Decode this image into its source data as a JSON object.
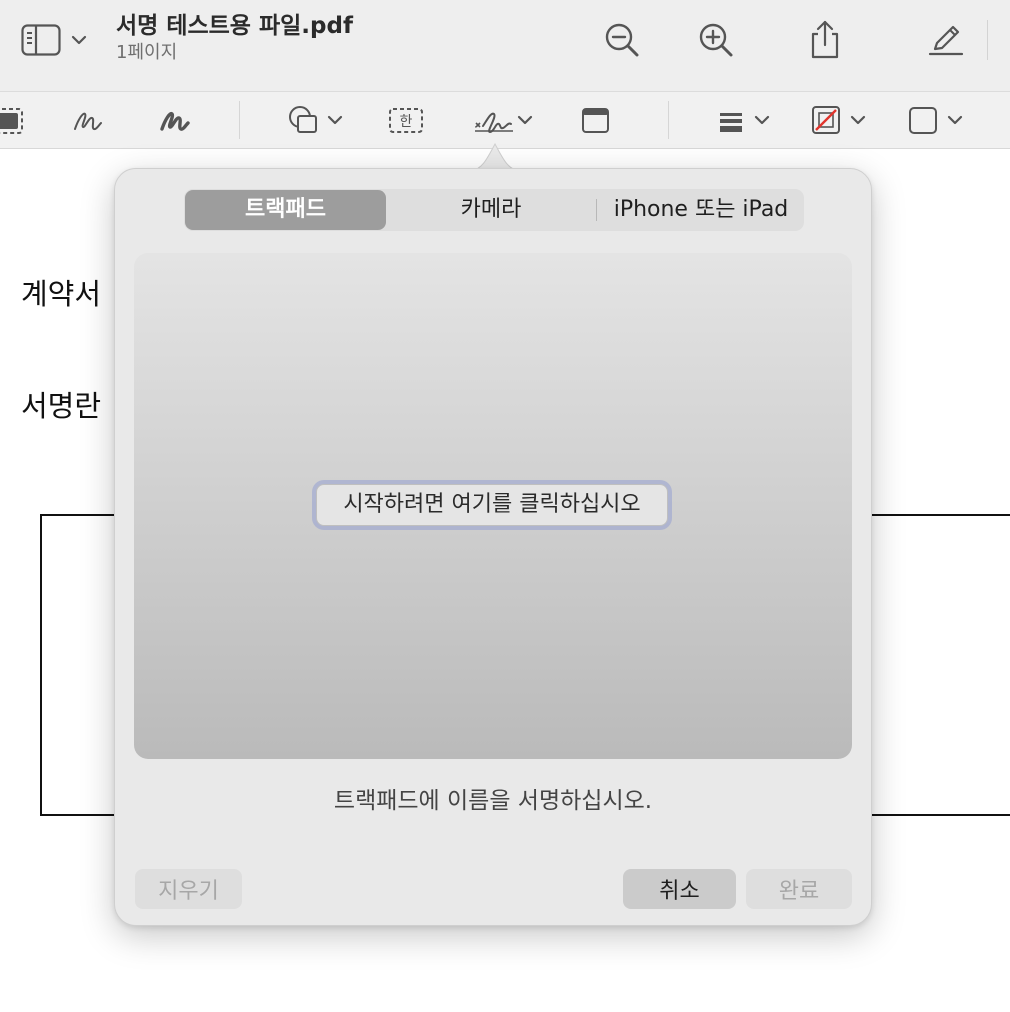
{
  "titlebar": {
    "title": "서명 테스트용 파일.pdf",
    "subtitle": "1페이지",
    "icons": [
      "sidebar-icon",
      "chevron-down-icon",
      "zoom-out-icon",
      "zoom-in-icon",
      "share-icon",
      "markup-pen-icon"
    ]
  },
  "markup_toolbar": {
    "tools": [
      "rect-selection-icon",
      "sketch-icon",
      "draw-icon",
      "shapes-icon",
      "text-box-icon",
      "signature-icon",
      "note-icon",
      "line-style-icon",
      "border-color-icon",
      "fill-color-icon"
    ],
    "text_tool_glyph": "한"
  },
  "document": {
    "heading": "계약서",
    "signature_label": "서명란"
  },
  "signature_popover": {
    "tabs": [
      {
        "label": "트랙패드",
        "active": true
      },
      {
        "label": "카메라",
        "active": false
      },
      {
        "label": "iPhone 또는 iPad",
        "active": false
      }
    ],
    "start_button": "시작하려면 여기를 클릭하십시오",
    "hint": "트랙패드에 이름을 서명하십시오.",
    "clear_button": "지우기",
    "cancel_button": "취소",
    "done_button": "완료"
  },
  "colors": {
    "toolbar_bg": "#eeeeee",
    "popover_bg": "#e9e9e9",
    "active_tab": "#9d9d9d",
    "focus_ring": "#96a0d2",
    "border_color_accent": "#e0342c"
  }
}
